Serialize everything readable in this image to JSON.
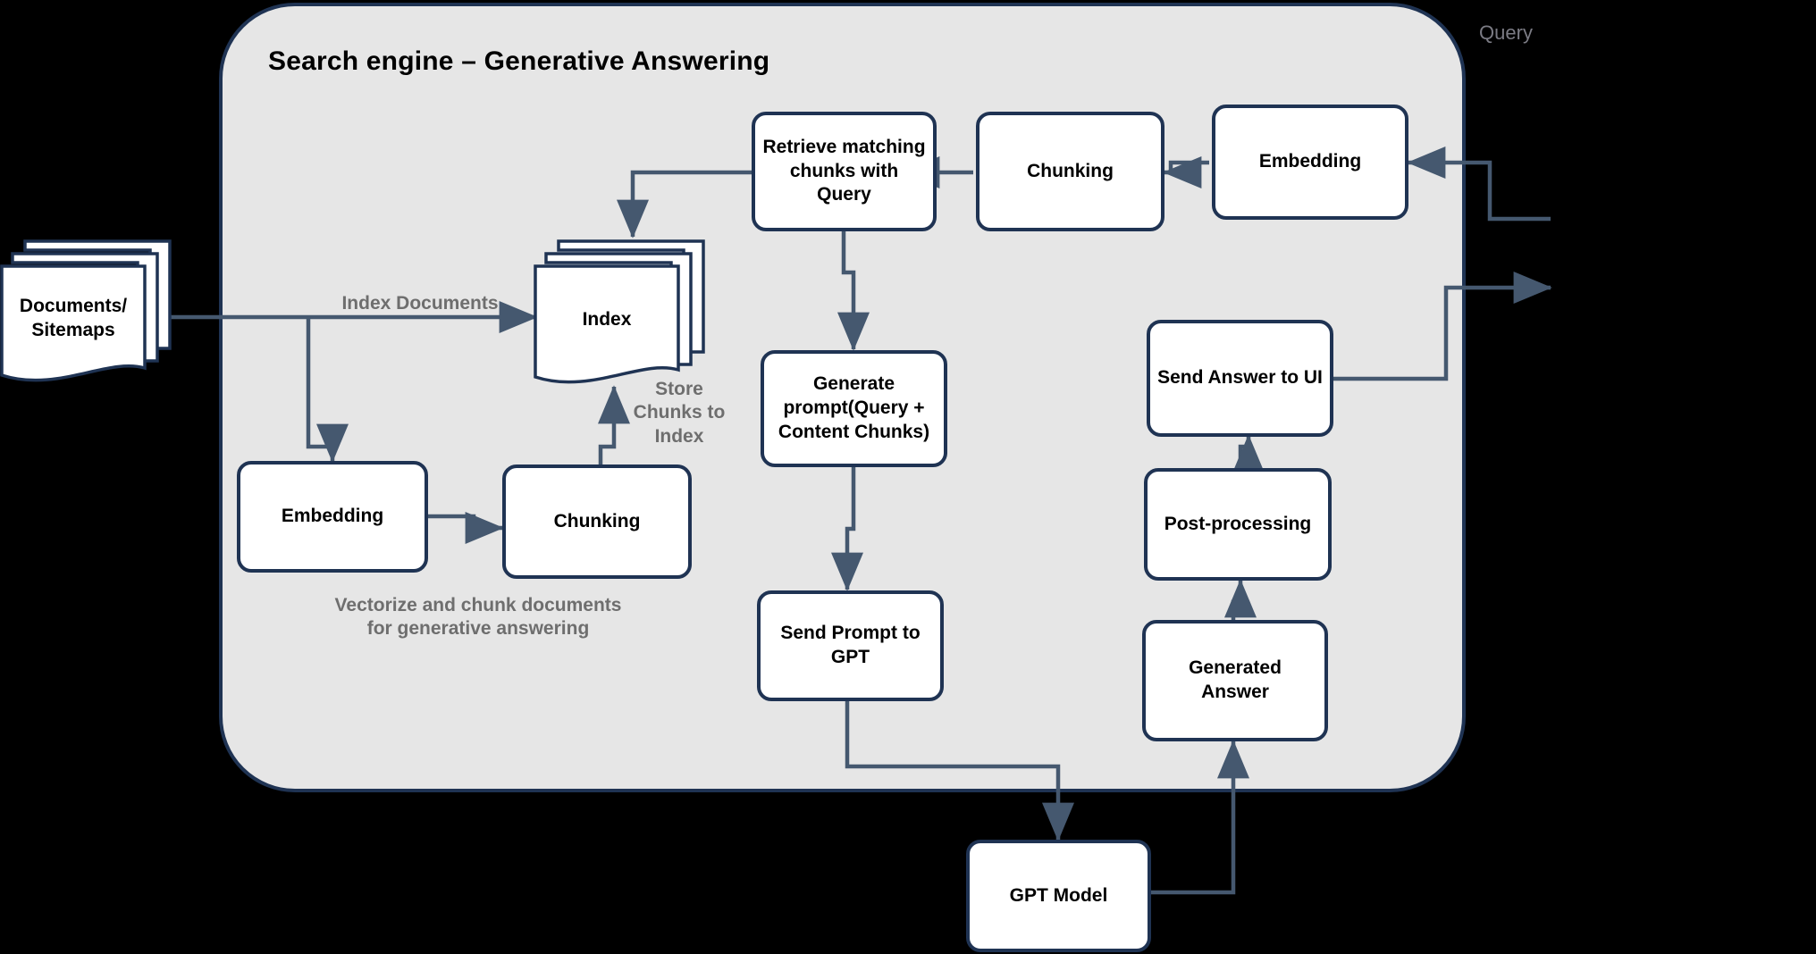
{
  "panel": {
    "title": "Search engine – Generative Answering",
    "accent_border": "#1F3353",
    "fill": "#E6E6E6",
    "canvas": "#000000",
    "connector": "#45586F",
    "note_color": "#6E6E6E"
  },
  "nodes": {
    "documents": {
      "label": "Documents/\nSitemaps"
    },
    "index": {
      "label": "Index"
    },
    "embedding_doc": {
      "label": "Embedding"
    },
    "chunking_doc": {
      "label": "Chunking"
    },
    "retrieve": {
      "label": "Retrieve matching chunks with Query"
    },
    "chunking_query": {
      "label": "Chunking"
    },
    "embedding_query": {
      "label": "Embedding"
    },
    "generate_prompt": {
      "label": "Generate prompt(Query + Content Chunks)"
    },
    "send_prompt": {
      "label": "Send Prompt to GPT"
    },
    "gpt_model": {
      "label": "GPT Model"
    },
    "generated_answer": {
      "label": "Generated Answer"
    },
    "post_processing": {
      "label": "Post-processing"
    },
    "send_answer": {
      "label": "Send Answer to UI"
    }
  },
  "annotations": {
    "query": "Query",
    "index_documents": "Index Documents",
    "store_chunks": "Store\nChunks to\nIndex",
    "vectorize": "Vectorize and chunk documents\nfor generative answering"
  },
  "flow_edges": [
    {
      "from": "documents",
      "to": "index",
      "label": "Index Documents"
    },
    {
      "from": "documents",
      "to": "embedding_doc",
      "label": ""
    },
    {
      "from": "embedding_doc",
      "to": "chunking_doc",
      "label": ""
    },
    {
      "from": "chunking_doc",
      "to": "index",
      "label": "Store Chunks to Index"
    },
    {
      "from": "query-input",
      "to": "embedding_query",
      "label": "Query"
    },
    {
      "from": "embedding_query",
      "to": "chunking_query",
      "label": ""
    },
    {
      "from": "chunking_query",
      "to": "retrieve",
      "label": ""
    },
    {
      "from": "retrieve",
      "to": "index",
      "label": ""
    },
    {
      "from": "retrieve",
      "to": "generate_prompt",
      "label": ""
    },
    {
      "from": "generate_prompt",
      "to": "send_prompt",
      "label": ""
    },
    {
      "from": "send_prompt",
      "to": "gpt_model",
      "label": ""
    },
    {
      "from": "gpt_model",
      "to": "generated_answer",
      "label": ""
    },
    {
      "from": "generated_answer",
      "to": "post_processing",
      "label": ""
    },
    {
      "from": "post_processing",
      "to": "send_answer",
      "label": ""
    },
    {
      "from": "send_answer",
      "to": "ui-output",
      "label": ""
    }
  ]
}
